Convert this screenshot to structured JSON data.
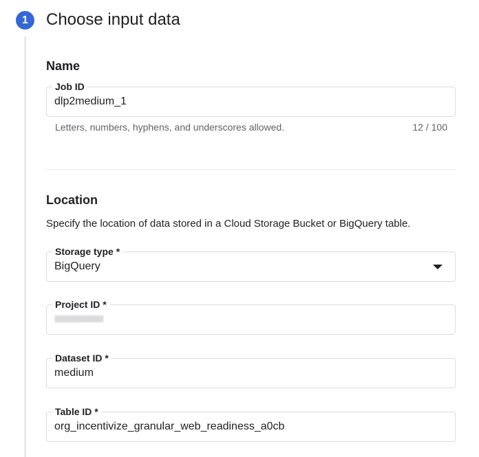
{
  "step": {
    "number": "1",
    "title": "Choose input data"
  },
  "name_section": {
    "heading": "Name",
    "job_id": {
      "label": "Job ID",
      "value": "dlp2medium_1",
      "helper": "Letters, numbers, hyphens, and underscores allowed.",
      "counter": "12 / 100"
    }
  },
  "location_section": {
    "heading": "Location",
    "description": "Specify the location of data stored in a Cloud Storage Bucket or BigQuery table.",
    "storage_type": {
      "label": "Storage type *",
      "value": "BigQuery"
    },
    "project_id": {
      "label": "Project ID *",
      "value": ""
    },
    "dataset_id": {
      "label": "Dataset ID *",
      "value": "medium"
    },
    "table_id": {
      "label": "Table ID *",
      "value": "org_incentivize_granular_web_readiness_a0cb"
    }
  },
  "colors": {
    "accent": "#3367d6",
    "border": "#dadce0",
    "helper_text": "#5f6368",
    "stepper_line": "#bdc1c6"
  },
  "icons": {
    "dropdown": "triangle-down-icon"
  }
}
